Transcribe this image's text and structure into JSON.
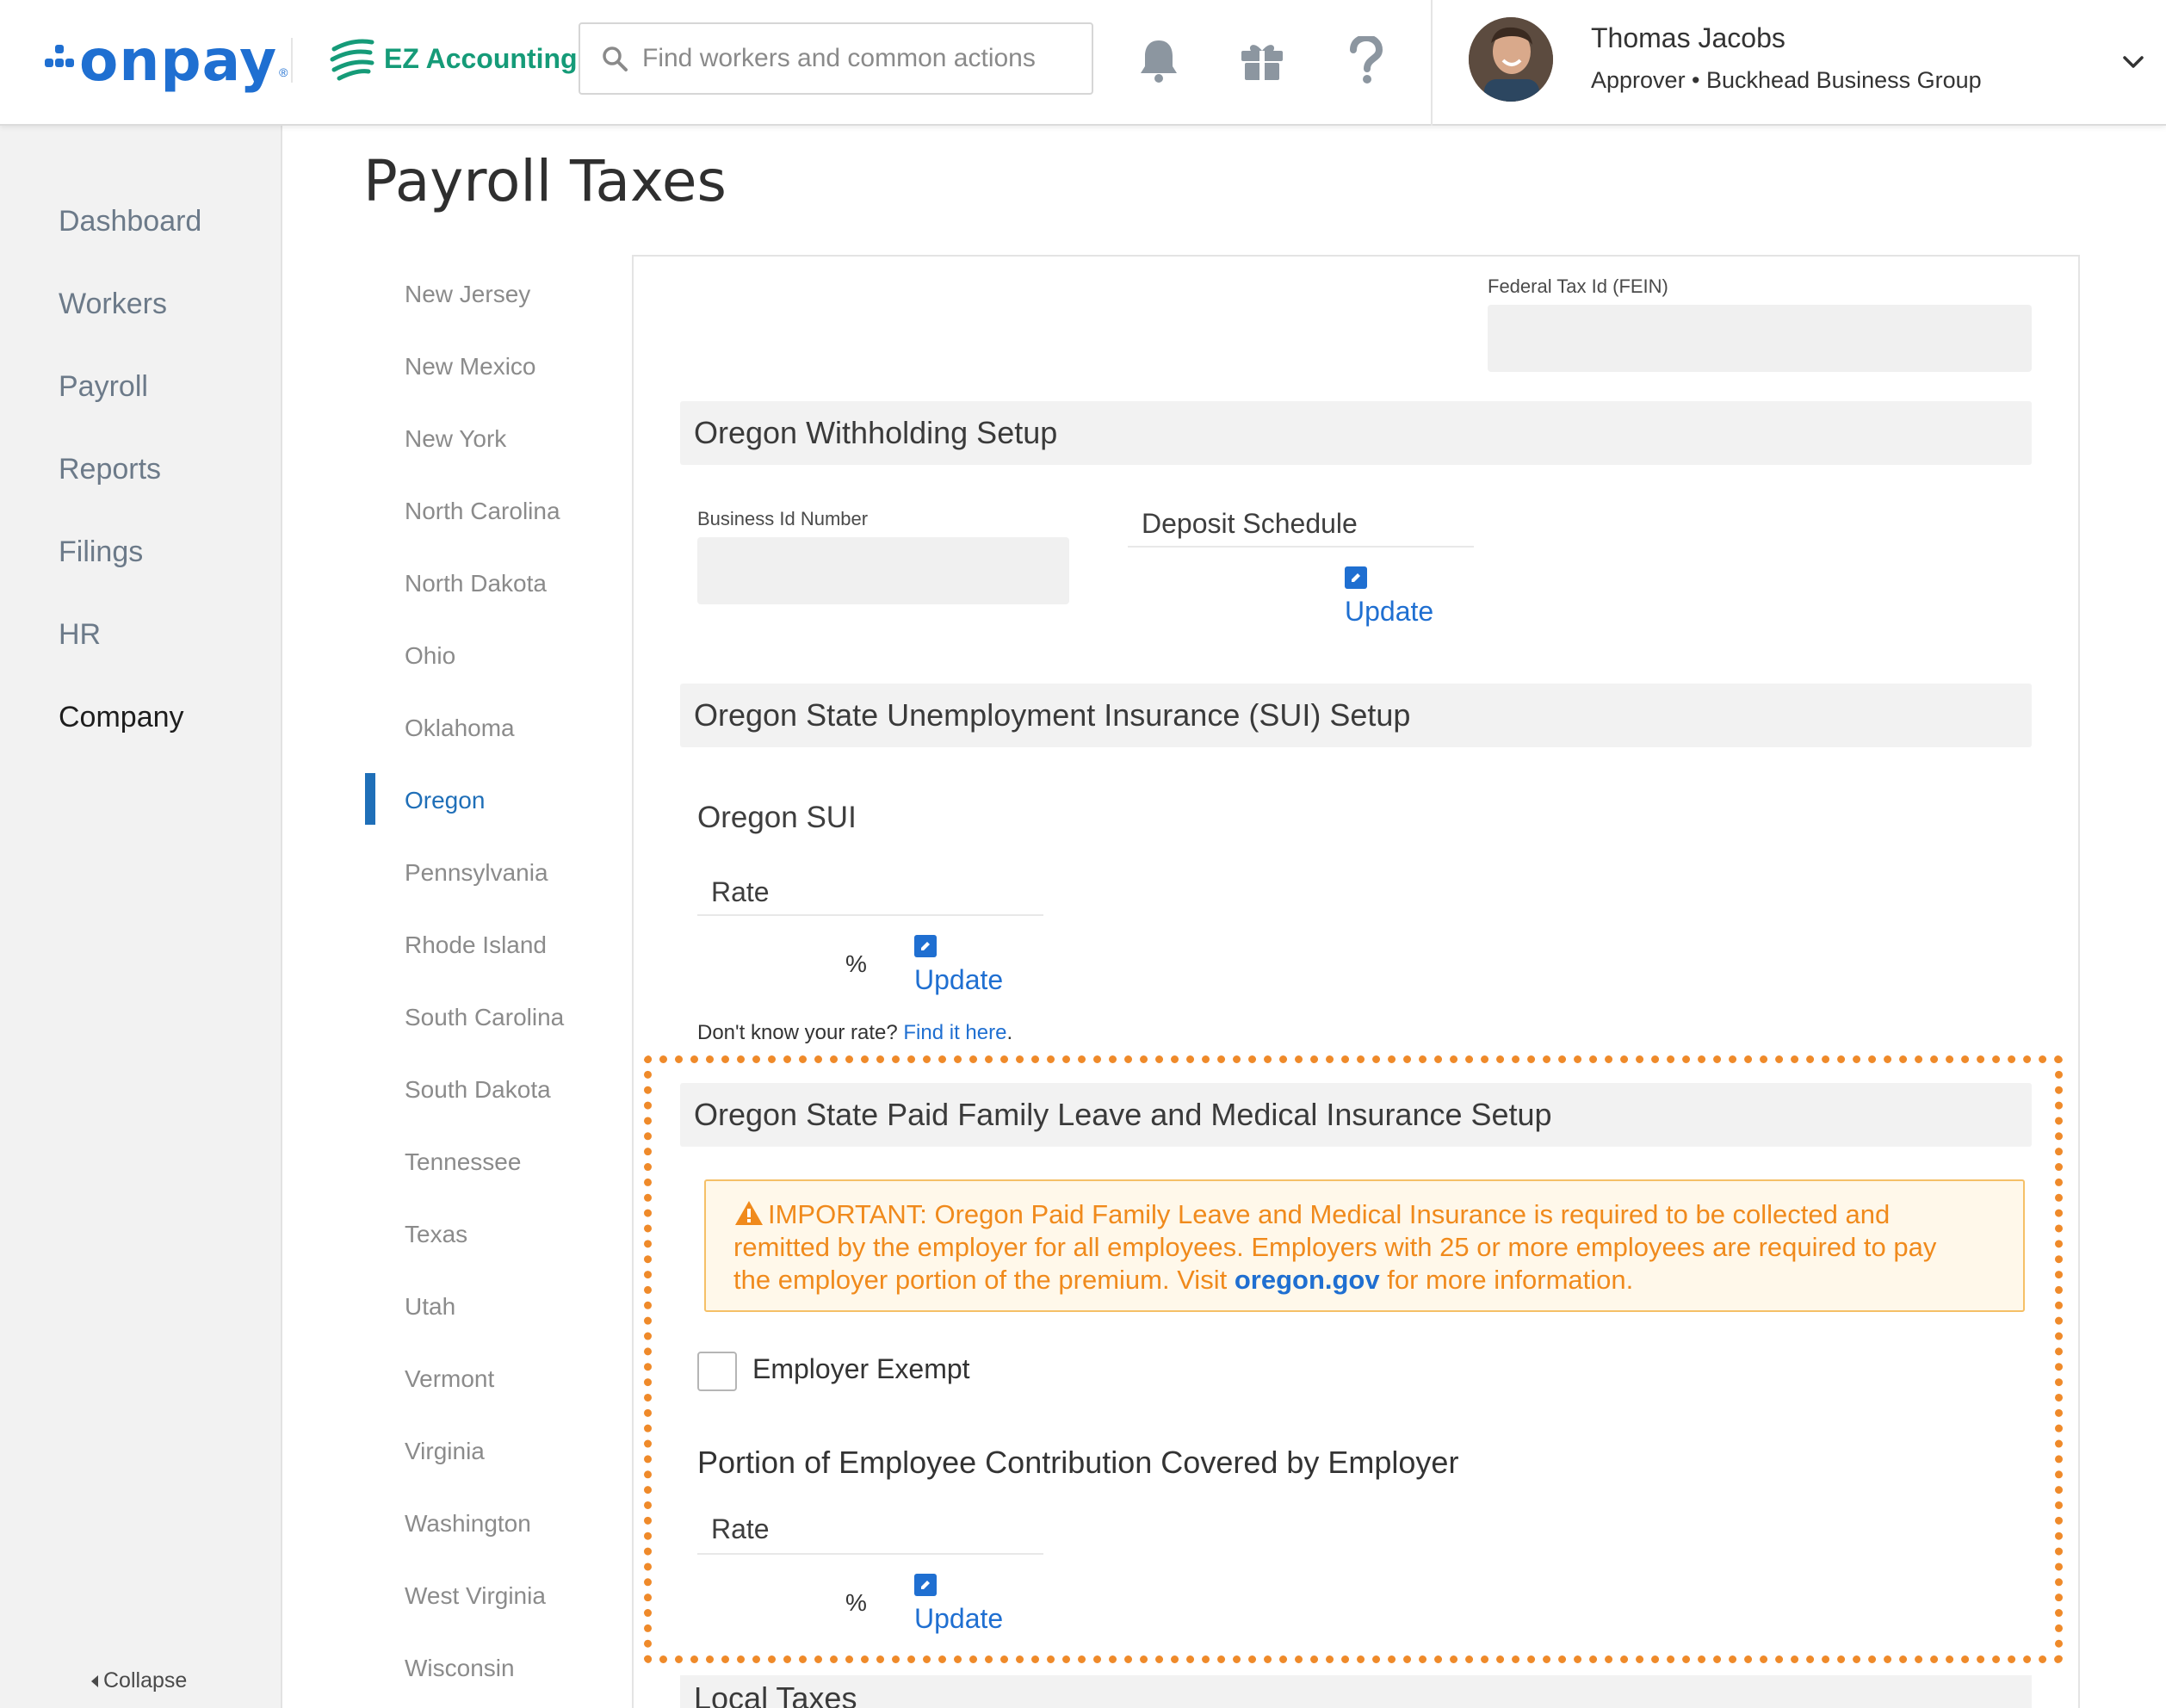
{
  "header": {
    "brand": "onpay",
    "brand_mark": "®",
    "partner": "EZ Accounting",
    "search_placeholder": "Find workers and common actions",
    "user": {
      "name": "Thomas Jacobs",
      "role": "Approver • Buckhead Business Group"
    }
  },
  "sidebar": {
    "items": [
      "Dashboard",
      "Workers",
      "Payroll",
      "Reports",
      "Filings",
      "HR",
      "Company"
    ],
    "active": "Company",
    "collapse_label": "Collapse"
  },
  "page": {
    "title": "Payroll Taxes"
  },
  "states": {
    "items": [
      "New Jersey",
      "New Mexico",
      "New York",
      "North Carolina",
      "North Dakota",
      "Ohio",
      "Oklahoma",
      "Oregon",
      "Pennsylvania",
      "Rhode Island",
      "South Carolina",
      "South Dakota",
      "Tennessee",
      "Texas",
      "Utah",
      "Vermont",
      "Virginia",
      "Washington",
      "West Virginia",
      "Wisconsin"
    ],
    "active": "Oregon"
  },
  "panel": {
    "fein_label": "Federal Tax Id (FEIN)",
    "withholding": {
      "title": "Oregon Withholding Setup",
      "business_id_label": "Business Id Number",
      "deposit_label": "Deposit Schedule",
      "update": "Update"
    },
    "sui": {
      "title": "Oregon State Unemployment Insurance (SUI) Setup",
      "subtitle": "Oregon SUI",
      "rate_label": "Rate",
      "pct": "%",
      "update": "Update",
      "hint_text": "Don't know your rate?",
      "hint_link": "Find it here",
      "hint_end": "."
    },
    "pfml": {
      "title": "Oregon State Paid Family Leave and Medical Insurance Setup",
      "warning_line1": "IMPORTANT: Oregon Paid Family Leave and Medical Insurance is required to be collected and",
      "warning_line2": "remitted by the employer for all employees. Employers with 25 or more employees are required to pay",
      "warning_line3_pre": "the employer portion of the premium. Visit",
      "warning_link": "oregon.gov",
      "warning_line3_post": "for more information.",
      "exempt_label": "Employer Exempt",
      "portion_title": "Portion of Employee Contribution Covered by Employer",
      "rate_label": "Rate",
      "pct": "%",
      "update": "Update"
    },
    "local": {
      "title": "Local Taxes"
    }
  },
  "colors": {
    "brand_blue": "#1f6fd1",
    "ez_green": "#159b78",
    "highlight_orange": "#ef8a2a",
    "warning_text": "#f08a1c"
  }
}
